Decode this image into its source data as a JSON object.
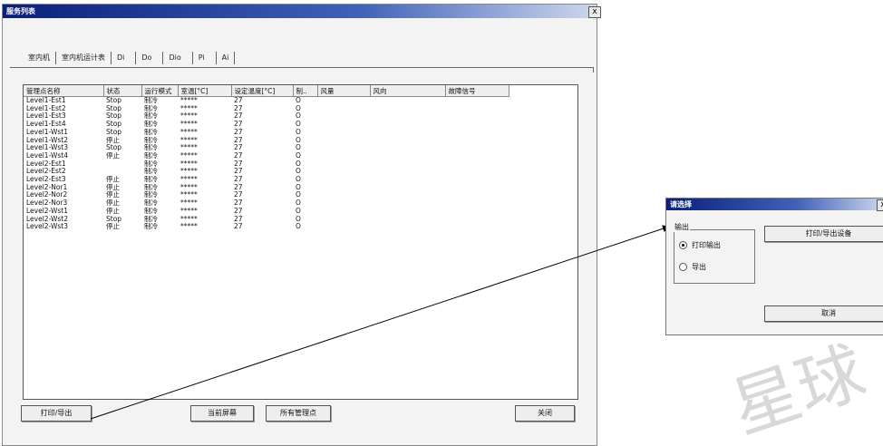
{
  "main_window": {
    "title": "服务列表",
    "close_glyph": "x",
    "tabs": [
      "室内机",
      "室内机运计表",
      "Di",
      "Do",
      "Dio",
      "Pi",
      "Ai"
    ],
    "columns": [
      "管理点名称",
      "状态",
      "运行模式",
      "室温[°C]",
      "设定温度[°C]",
      "制..",
      "风量",
      "风向",
      "故障信号"
    ],
    "rows": [
      [
        "Level1-Est1",
        "Stop",
        "制冷",
        "*****",
        "27",
        "O"
      ],
      [
        "Level1-Est2",
        "Stop",
        "制冷",
        "*****",
        "27",
        "O"
      ],
      [
        "Level1-Est3",
        "Stop",
        "制冷",
        "*****",
        "27",
        "O"
      ],
      [
        "Level1-Est4",
        "Stop",
        "制冷",
        "*****",
        "27",
        "O"
      ],
      [
        "Level1-Wst1",
        "Stop",
        "制冷",
        "*****",
        "27",
        "O"
      ],
      [
        "Level1-Wst2",
        "停止",
        "制冷",
        "*****",
        "27",
        "O"
      ],
      [
        "Level1-Wst3",
        "Stop",
        "制冷",
        "*****",
        "27",
        "O"
      ],
      [
        "Level1-Wst4",
        "停止",
        "制冷",
        "*****",
        "27",
        "O"
      ],
      [
        "Level2-Est1",
        "",
        "制冷",
        "*****",
        "27",
        "O"
      ],
      [
        "Level2-Est2",
        "",
        "制冷",
        "*****",
        "27",
        "O"
      ],
      [
        "Level2-Est3",
        "停止",
        "制冷",
        "*****",
        "27",
        "O"
      ],
      [
        "Level2-Nor1",
        "停止",
        "制冷",
        "*****",
        "27",
        "O"
      ],
      [
        "Level2-Nor2",
        "停止",
        "制冷",
        "*****",
        "27",
        "O"
      ],
      [
        "Level2-Nor3",
        "停止",
        "制冷",
        "*****",
        "27",
        "O"
      ],
      [
        "Level2-Wst1",
        "停止",
        "制冷",
        "*****",
        "27",
        "O"
      ],
      [
        "Level2-Wst2",
        "Stop",
        "制冷",
        "*****",
        "27",
        "O"
      ],
      [
        "Level2-Wst3",
        "停止",
        "制冷",
        "*****",
        "27",
        "O"
      ]
    ],
    "buttons": {
      "print": "打印/导出",
      "current_screen": "当前屏幕",
      "all_points": "所有管理点",
      "close": "关闭"
    }
  },
  "dialog": {
    "title": "请选择",
    "close_glyph": "x",
    "group_label": "输出",
    "option_print": "打印输出",
    "option_export": "导出",
    "device_button": "打印/导出设备",
    "cancel_button": "取消"
  },
  "watermark": "星球",
  "colors": {
    "title_dark": "#0a1f7a",
    "title_light": "#ced7ec",
    "panel": "#f3f3f3",
    "watermark": "#d8d8d8"
  }
}
